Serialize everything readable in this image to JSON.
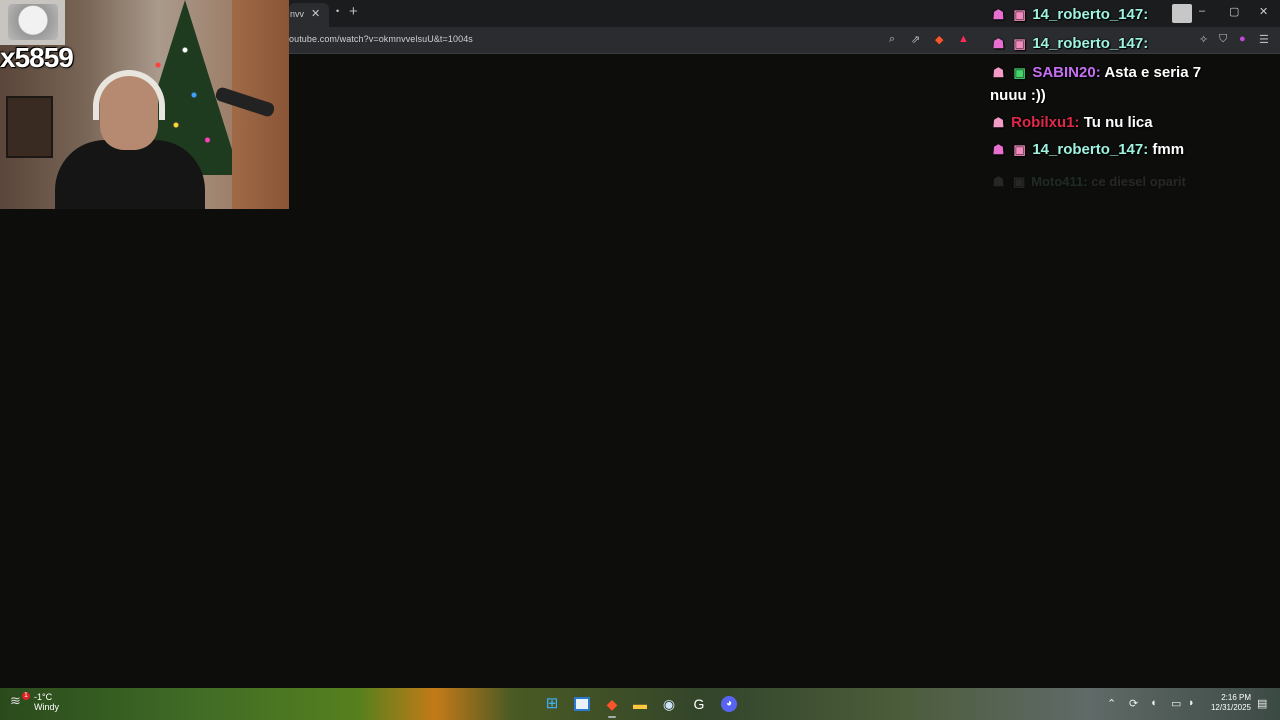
{
  "browser": {
    "tab_title": "nvv",
    "tab_close": "✕",
    "tab_more": "•",
    "new_tab": "+",
    "url": "outube.com/watch?v=okmnvvelsuU&t=1004s",
    "window_controls": {
      "minimize": "–",
      "maximize": "▢",
      "close": "✕"
    }
  },
  "webcam": {
    "counter": "x5859"
  },
  "chat": {
    "messages": [
      {
        "badges": [
          "face-icon",
          "gift-icon"
        ],
        "username": "14_roberto_147:",
        "username_color": "#9ef3e0",
        "text": ""
      },
      {
        "badges": [
          "face-icon",
          "gift-icon"
        ],
        "username": "14_roberto_147:",
        "username_color": "#9ef3e0",
        "text": ""
      },
      {
        "badges": [
          "face-icon",
          "gift-icon"
        ],
        "username": "SABIN20:",
        "username_color": "#c56ff2",
        "text": "Asta e seria 7 nuuu :))"
      },
      {
        "badges": [
          "face-icon"
        ],
        "username": "Robilxu1:",
        "username_color": "#e0284a",
        "text": "Tu nu lica"
      },
      {
        "badges": [
          "face-icon",
          "gift-icon"
        ],
        "username": "14_roberto_147:",
        "username_color": "#9ef3e0",
        "text": "fmm"
      },
      {
        "badges": [
          "face-icon",
          "gift-icon"
        ],
        "username": "Moto411:",
        "username_color": "#9ef3e0",
        "text": "ce diesel oparit"
      }
    ]
  },
  "taskbar": {
    "weather_temp": "-1°C",
    "weather_desc": "Windy",
    "weather_badge": "1",
    "discord_badge": "",
    "time": "2:16 PM",
    "date": "12/31/2025"
  },
  "colors": {
    "page_bg": "#0d0e0c",
    "chrome_bg": "#1b1c1e",
    "addressbar_bg": "#2b2c2f"
  }
}
